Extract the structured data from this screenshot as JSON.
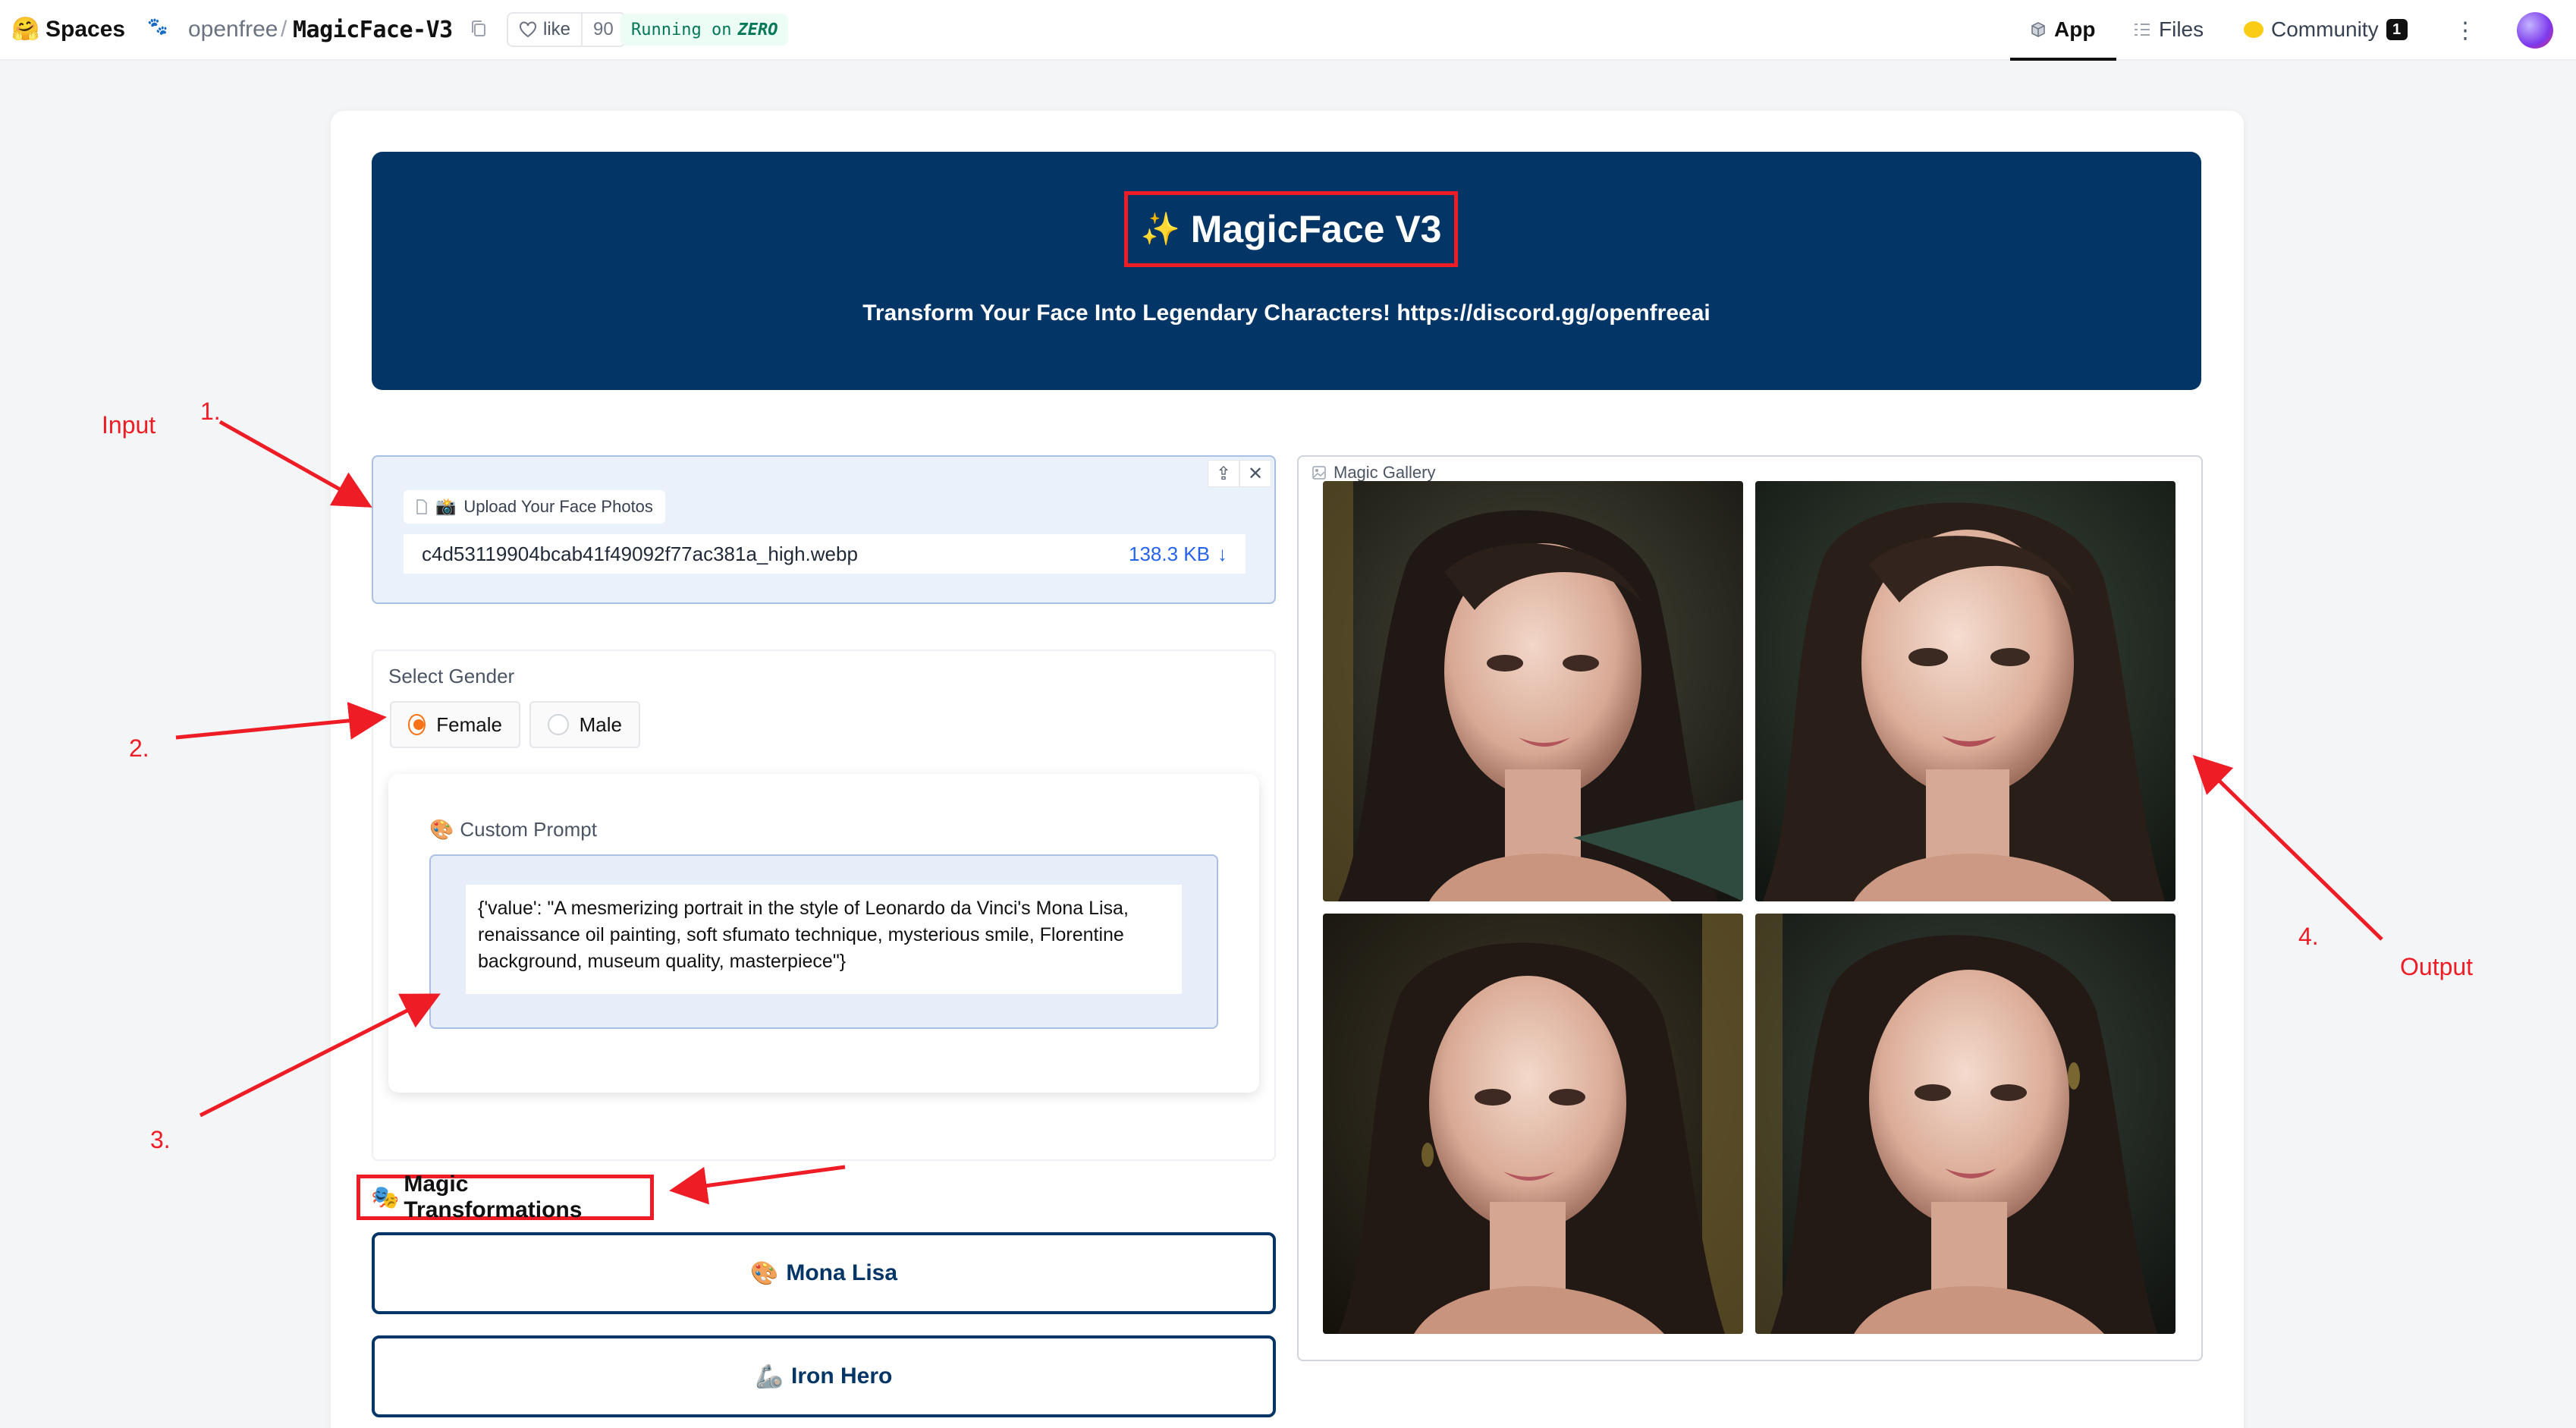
{
  "topbar": {
    "brand": "Spaces",
    "org": "openfree",
    "separator": "/",
    "repo": "MagicFace-V3",
    "like_label": "like",
    "like_count": "90",
    "running_prefix": "Running on",
    "running_hw": "ZERO",
    "tabs": [
      {
        "label": "App"
      },
      {
        "label": "Files"
      },
      {
        "label": "Community",
        "badge": "1"
      }
    ],
    "kebab": "⋮"
  },
  "banner": {
    "title": "MagicFace V3",
    "sparkle": "✨",
    "subtitle": "Transform Your Face Into Legendary Characters! https://discord.gg/openfreeai"
  },
  "upload": {
    "label": "Upload Your Face Photos",
    "label_emoji": "📸",
    "file_name": "c4d53119904bcab41f49092f77ac381a_high.webp",
    "file_size": "138.3 KB",
    "download_glyph": "↓",
    "upload_glyph": "⇪",
    "close_glyph": "✕"
  },
  "gender": {
    "label": "Select Gender",
    "options": [
      {
        "label": "Female",
        "selected": true
      },
      {
        "label": "Male",
        "selected": false
      }
    ]
  },
  "prompt": {
    "label": "Custom Prompt",
    "label_emoji": "🎨",
    "value": "{'value': \"A mesmerizing portrait in the style of Leonardo da Vinci's Mona Lisa, renaissance oil painting, soft sfumato technique, mysterious smile, Florentine background, museum quality, masterpiece\"}"
  },
  "transformations": {
    "heading": "Magic Transformations",
    "heading_emoji": "🎭",
    "buttons": [
      {
        "label": "Mona Lisa",
        "emoji": "🎨"
      },
      {
        "label": "Iron Hero",
        "emoji": "🦾"
      }
    ]
  },
  "gallery": {
    "label": "Magic Gallery",
    "images": 4
  },
  "annotations": {
    "input": "Input",
    "output": "Output",
    "n1": "1.",
    "n2": "2.",
    "n3": "3.",
    "n4": "4."
  },
  "colors": {
    "banner_bg": "#033566",
    "annotation_red": "#ee1c25",
    "radio_accent": "#f97316",
    "upload_bg": "#eaf1fb"
  }
}
